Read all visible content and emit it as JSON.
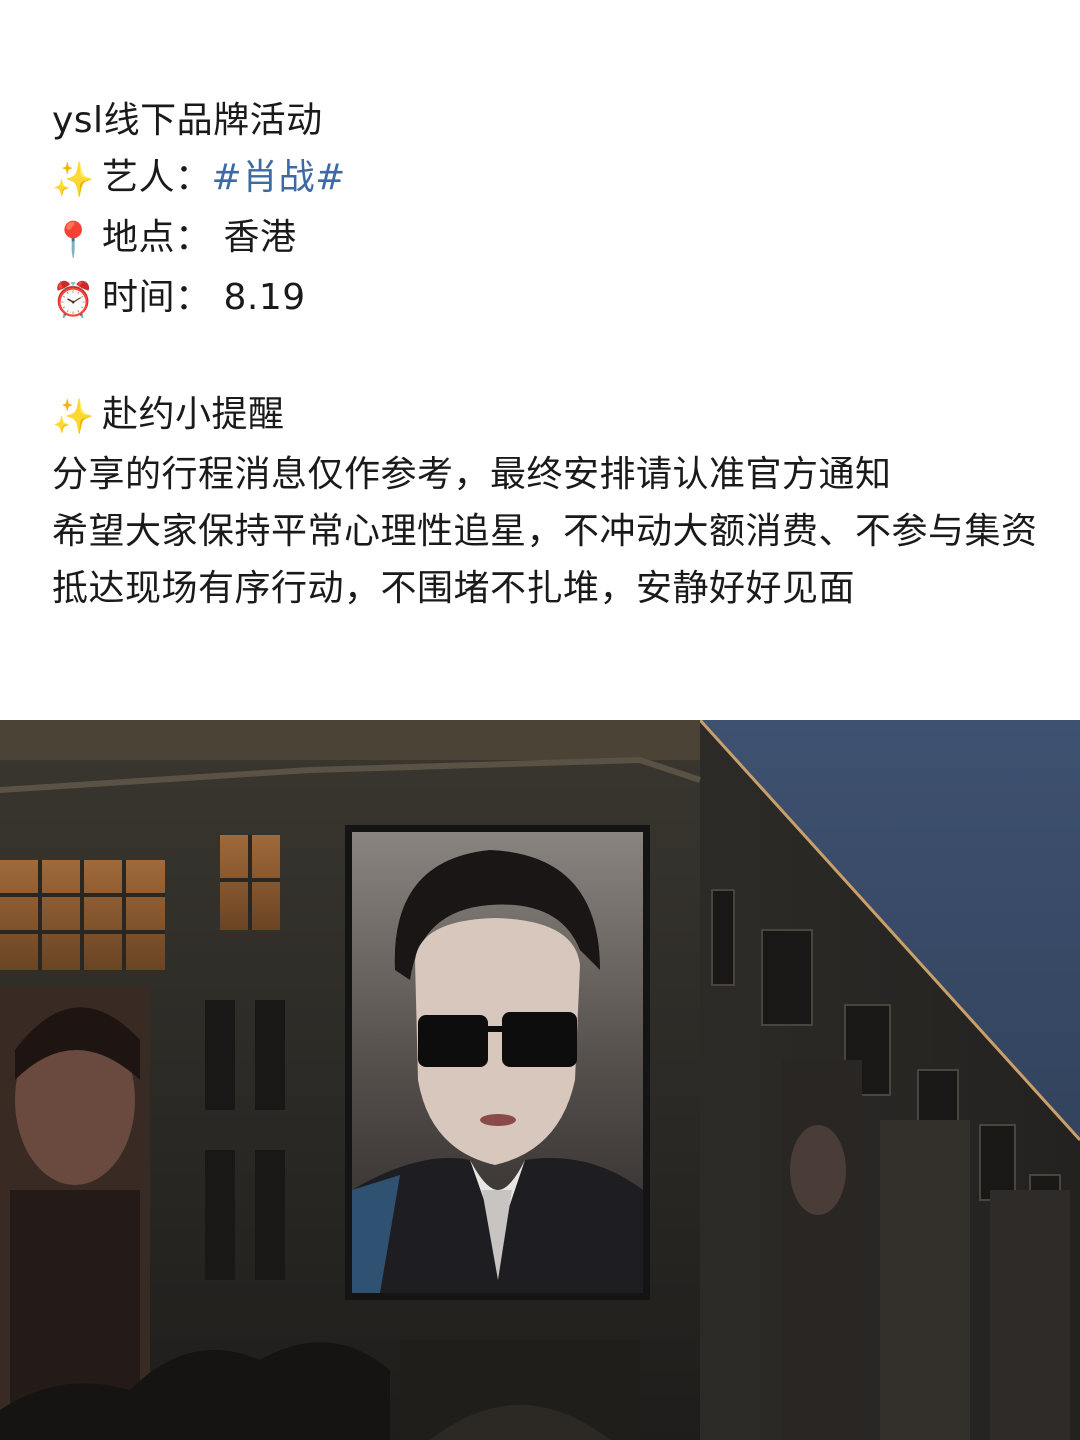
{
  "post": {
    "title": "ysl线下品牌活动",
    "artist_label": "艺人：",
    "artist_tag": "#肖战#",
    "location_label": "地点：",
    "location_value": "香港",
    "time_label": "时间：",
    "time_value": "8.19",
    "reminder_heading": "赴约小提醒",
    "reminder_lines": [
      "分享的行程消息仅作参考，最终安排请认准官方通知",
      "希望大家保持平常心理性追星，不冲动大额消费、不参与集资",
      "抵达现场有序行动，不围堵不扎堆，安静好好见面"
    ]
  },
  "icons": {
    "sparkle": "sparkles-icon",
    "pin": "round-pushpin-icon",
    "clock": "alarm-clock-icon"
  },
  "colors": {
    "text": "#1a1a1a",
    "hashtag": "#3d6aa3",
    "sky": "#34455e",
    "building": "#2b2a27"
  }
}
